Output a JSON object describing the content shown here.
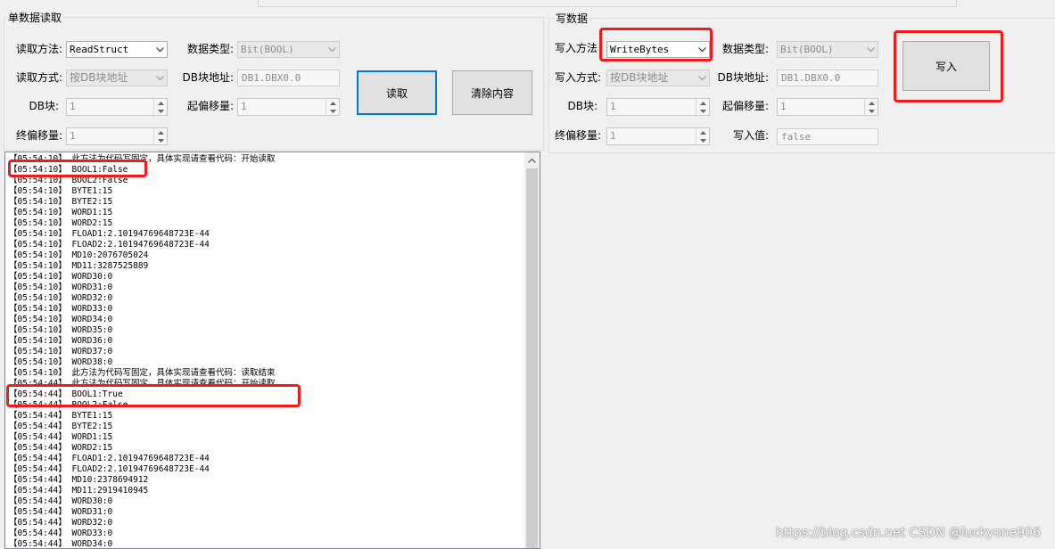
{
  "read_panel": {
    "title": "单数据读取",
    "method_label": "读取方法:",
    "method_value": "ReadStruct",
    "datatype_label": "数据类型:",
    "datatype_value": "Bit(BOOL)",
    "mode_label": "读取方式:",
    "mode_value": "按DB块地址",
    "dbaddr_label": "DB块地址:",
    "dbaddr_value": "DB1.DBX0.0",
    "db_label": "DB块:",
    "db_value": "1",
    "start_offset_label": "起偏移量:",
    "start_offset_value": "1",
    "end_offset_label": "终偏移量:",
    "end_offset_value": "1",
    "read_button": "读取",
    "clear_button": "清除内容"
  },
  "write_panel": {
    "title": "写数据",
    "method_label": "写入方法",
    "method_value": "WriteBytes",
    "datatype_label": "数据类型:",
    "datatype_value": "Bit(BOOL)",
    "mode_label": "写入方式:",
    "mode_value": "按DB块地址",
    "dbaddr_label": "DB块地址:",
    "dbaddr_value": "DB1.DBX0.0",
    "db_label": "DB块:",
    "db_value": "1",
    "start_offset_label": "起偏移量:",
    "start_offset_value": "1",
    "end_offset_label": "终偏移量:",
    "end_offset_value": "1",
    "write_value_label": "写入值:",
    "write_value_value": "false",
    "write_button": "写入"
  },
  "log": {
    "lines": [
      "【05:54:10】 此方法为代码写固定，具体实现请查看代码：开始读取",
      "【05:54:10】 BOOL1:False",
      "【05:54:10】 BOOL2:False",
      "【05:54:10】 BYTE1:15",
      "【05:54:10】 BYTE2:15",
      "【05:54:10】 WORD1:15",
      "【05:54:10】 WORD2:15",
      "【05:54:10】 FLOAD1:2.10194769648723E-44",
      "【05:54:10】 FLOAD2:2.10194769648723E-44",
      "【05:54:10】 MD10:2076705024",
      "【05:54:10】 MD11:3287525889",
      "【05:54:10】 WORD30:0",
      "【05:54:10】 WORD31:0",
      "【05:54:10】 WORD32:0",
      "【05:54:10】 WORD33:0",
      "【05:54:10】 WORD34:0",
      "【05:54:10】 WORD35:0",
      "【05:54:10】 WORD36:0",
      "【05:54:10】 WORD37:0",
      "【05:54:10】 WORD38:0",
      "【05:54:10】 此方法为代码写固定，具体实现请查看代码：读取结束",
      "【05:54:44】 此方法为代码写固定，具体实现请查看代码：开始读取",
      "【05:54:44】 BOOL1:True",
      "【05:54:44】 BOOL2:False",
      "【05:54:44】 BYTE1:15",
      "【05:54:44】 BYTE2:15",
      "【05:54:44】 WORD1:15",
      "【05:54:44】 WORD2:15",
      "【05:54:44】 FLOAD1:2.10194769648723E-44",
      "【05:54:44】 FLOAD2:2.10194769648723E-44",
      "【05:54:44】 MD10:2378694912",
      "【05:54:44】 MD11:2919410945",
      "【05:54:44】 WORD30:0",
      "【05:54:44】 WORD31:0",
      "【05:54:44】 WORD32:0",
      "【05:54:44】 WORD33:0",
      "【05:54:44】 WORD34:0"
    ]
  },
  "watermark": "https://blog.csdn.net CSDN @luckyone906"
}
